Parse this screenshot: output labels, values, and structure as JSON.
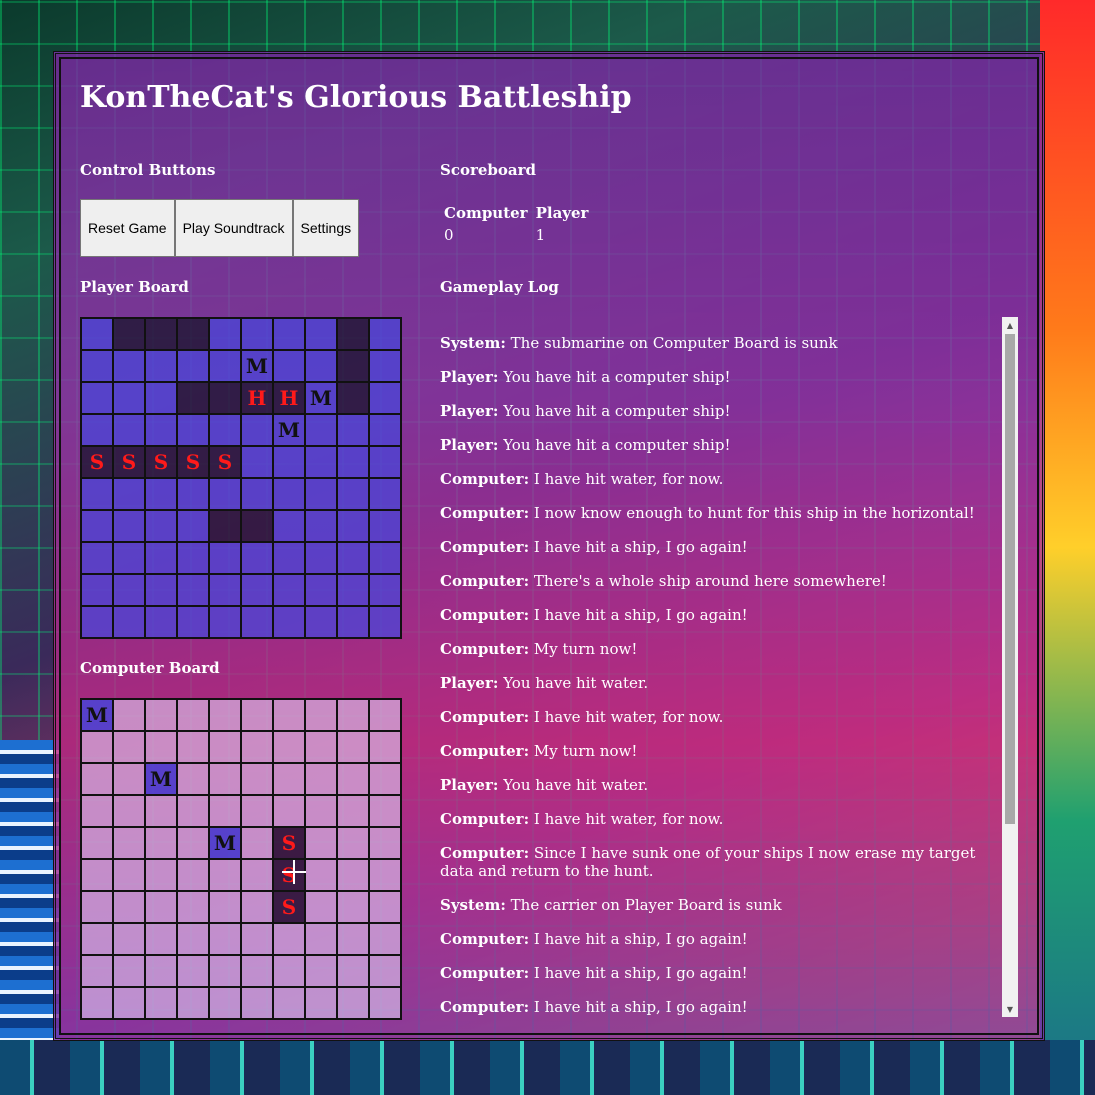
{
  "title": "KonTheCat's Glorious Battleship",
  "sections": {
    "controls": "Control Buttons",
    "scoreboard": "Scoreboard",
    "player_board": "Player Board",
    "computer_board": "Computer Board",
    "log": "Gameplay Log"
  },
  "buttons": {
    "reset": "Reset Game",
    "soundtrack": "Play Soundtrack",
    "settings": "Settings"
  },
  "scoreboard": {
    "headers": [
      "Computer",
      "Player"
    ],
    "scores": [
      "0",
      "1"
    ]
  },
  "player_board": [
    [
      "",
      "#",
      "#",
      "#",
      "",
      "",
      "",
      "",
      "#",
      ""
    ],
    [
      "",
      "",
      "",
      "",
      "",
      "M",
      "",
      "",
      "#",
      ""
    ],
    [
      "",
      "",
      "",
      "#",
      "#",
      "H",
      "H",
      "M",
      "#",
      ""
    ],
    [
      "",
      "",
      "",
      "",
      "",
      "",
      "M",
      "",
      "",
      ""
    ],
    [
      "S",
      "S",
      "S",
      "S",
      "S",
      "",
      "",
      "",
      "",
      ""
    ],
    [
      "",
      "",
      "",
      "",
      "",
      "",
      "",
      "",
      "",
      ""
    ],
    [
      "",
      "",
      "",
      "",
      "#",
      "#",
      "",
      "",
      "",
      ""
    ],
    [
      "",
      "",
      "",
      "",
      "",
      "",
      "",
      "",
      "",
      ""
    ],
    [
      "",
      "",
      "",
      "",
      "",
      "",
      "",
      "",
      "",
      ""
    ],
    [
      "",
      "",
      "",
      "",
      "",
      "",
      "",
      "",
      "",
      ""
    ]
  ],
  "computer_board": [
    [
      "M",
      "",
      "",
      "",
      "",
      "",
      "",
      "",
      "",
      ""
    ],
    [
      "",
      "",
      "",
      "",
      "",
      "",
      "",
      "",
      "",
      ""
    ],
    [
      "",
      "",
      "M",
      "",
      "",
      "",
      "",
      "",
      "",
      ""
    ],
    [
      "",
      "",
      "",
      "",
      "",
      "",
      "",
      "",
      "",
      ""
    ],
    [
      "",
      "",
      "",
      "",
      "M",
      "",
      "S",
      "",
      "",
      ""
    ],
    [
      "",
      "",
      "",
      "",
      "",
      "",
      "S",
      "",
      "",
      ""
    ],
    [
      "",
      "",
      "",
      "",
      "",
      "",
      "S",
      "",
      "",
      ""
    ],
    [
      "",
      "",
      "",
      "",
      "",
      "",
      "",
      "",
      "",
      ""
    ],
    [
      "",
      "",
      "",
      "",
      "",
      "",
      "",
      "",
      "",
      ""
    ],
    [
      "",
      "",
      "",
      "",
      "",
      "",
      "",
      "",
      "",
      ""
    ]
  ],
  "log": [
    {
      "speaker": "System:",
      "text": "The submarine on Computer Board is sunk"
    },
    {
      "speaker": "Player:",
      "text": "You have hit a computer ship!"
    },
    {
      "speaker": "Player:",
      "text": "You have hit a computer ship!"
    },
    {
      "speaker": "Player:",
      "text": "You have hit a computer ship!"
    },
    {
      "speaker": "Computer:",
      "text": "I have hit water, for now."
    },
    {
      "speaker": "Computer:",
      "text": "I now know enough to hunt for this ship in the horizontal!"
    },
    {
      "speaker": "Computer:",
      "text": "I have hit a ship, I go again!"
    },
    {
      "speaker": "Computer:",
      "text": "There's a whole ship around here somewhere!"
    },
    {
      "speaker": "Computer:",
      "text": "I have hit a ship, I go again!"
    },
    {
      "speaker": "Computer:",
      "text": "My turn now!"
    },
    {
      "speaker": "Player:",
      "text": "You have hit water."
    },
    {
      "speaker": "Computer:",
      "text": "I have hit water, for now."
    },
    {
      "speaker": "Computer:",
      "text": "My turn now!"
    },
    {
      "speaker": "Player:",
      "text": "You have hit water."
    },
    {
      "speaker": "Computer:",
      "text": "I have hit water, for now."
    },
    {
      "speaker": "Computer:",
      "text": "Since I have sunk one of your ships I now erase my target data and return to the hunt."
    },
    {
      "speaker": "System:",
      "text": "The carrier on Player Board is sunk"
    },
    {
      "speaker": "Computer:",
      "text": "I have hit a ship, I go again!"
    },
    {
      "speaker": "Computer:",
      "text": "I have hit a ship, I go again!"
    },
    {
      "speaker": "Computer:",
      "text": "I have hit a ship, I go again!"
    }
  ]
}
